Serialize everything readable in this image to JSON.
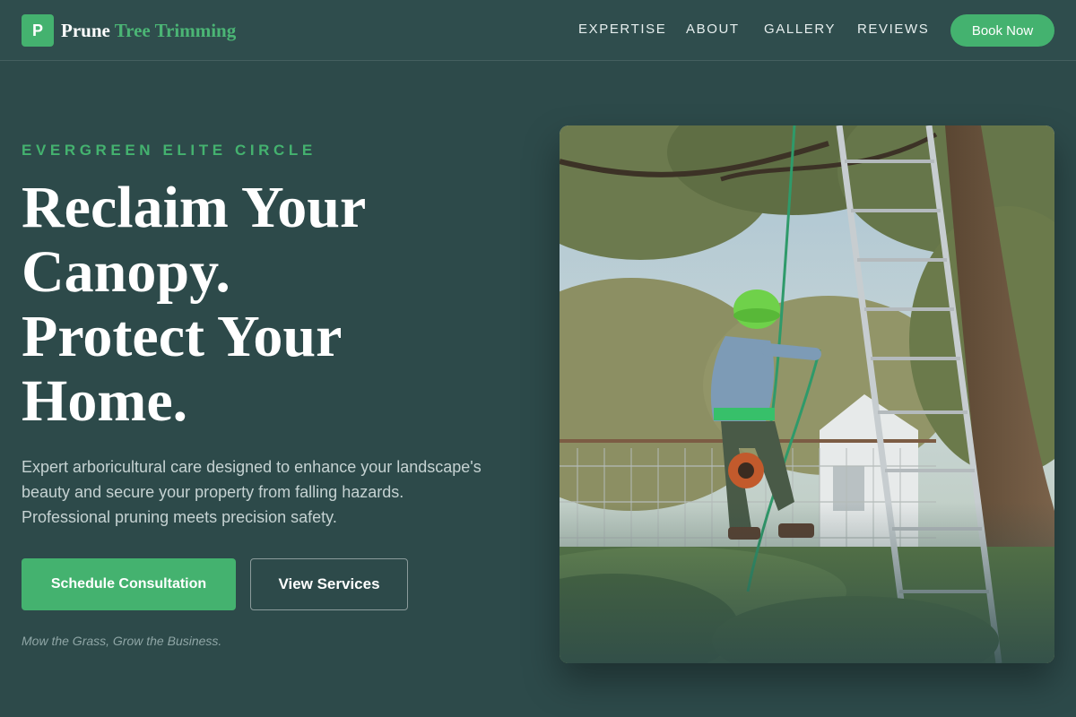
{
  "brand": {
    "mark": "P",
    "name_primary": "Prune",
    "name_accent": "Tree Trimming",
    "accent_color": "#44b26f"
  },
  "nav": {
    "items": [
      {
        "label": "EXPERTISE"
      },
      {
        "label": "ABOUT"
      },
      {
        "label": "GALLERY"
      },
      {
        "label": "REVIEWS"
      }
    ],
    "cta_label": "Book Now"
  },
  "hero": {
    "eyebrow": "EVERGREEN ELITE CIRCLE",
    "headline_lines": [
      "Reclaim Your",
      "Canopy.",
      "Protect Your",
      "Home."
    ],
    "subheadline": "Expert arboricultural care designed to enhance your landscape's beauty and secure your property from falling hazards. Professional pruning meets precision safety.",
    "primary_cta": "Schedule Consultation",
    "secondary_cta": "View Services",
    "tagline": "Mow the Grass, Grow the Business.",
    "image_icon": "arborist-climbing-tree-photo"
  },
  "colors": {
    "background": "#2d4a4a",
    "accent": "#44b26f",
    "text_primary": "#ffffff",
    "text_muted": "#c5d2d2"
  }
}
